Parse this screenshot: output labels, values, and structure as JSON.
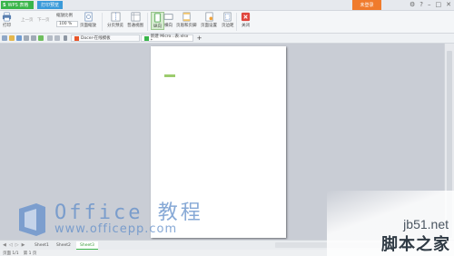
{
  "titlebar": {
    "app_mark": "S",
    "app_name": "WPS 表格",
    "active_tab": "打印预览",
    "login_label": "未登录",
    "controls": [
      "⚙",
      "?",
      "–",
      "□",
      "✕"
    ]
  },
  "ribbon": {
    "print": "打印",
    "prev": "上一页",
    "next": "下一页",
    "zoom_label": "缩放比例",
    "zoom_value": "100 %",
    "scale": "页面缩放",
    "page_break": "分页预览",
    "normal_view": "普通视图",
    "portrait": "纵向",
    "landscape": "横向",
    "header_footer": "页眉和页脚",
    "page_setup": "页面设置",
    "margins": "页边距",
    "close": "关闭"
  },
  "tabs": {
    "docer": "Docer-在线模板",
    "current": "新建 Micro...表.xlsx *",
    "add": "+"
  },
  "sheets": {
    "sheet1": "Sheet1",
    "sheet2": "Sheet2",
    "sheet3": "Sheet3"
  },
  "status": {
    "left": "页面 1/1",
    "right": "第 1 页"
  },
  "watermark": {
    "title": "Office 教程",
    "url": "www.officepp.com",
    "site": "jb51.net",
    "site_cn": "脚本之家"
  },
  "colors": {
    "brand_green": "#39b54a",
    "accent_blue": "#3a9ad9",
    "login_orange": "#f07b2c",
    "close_red": "#e0463d"
  }
}
